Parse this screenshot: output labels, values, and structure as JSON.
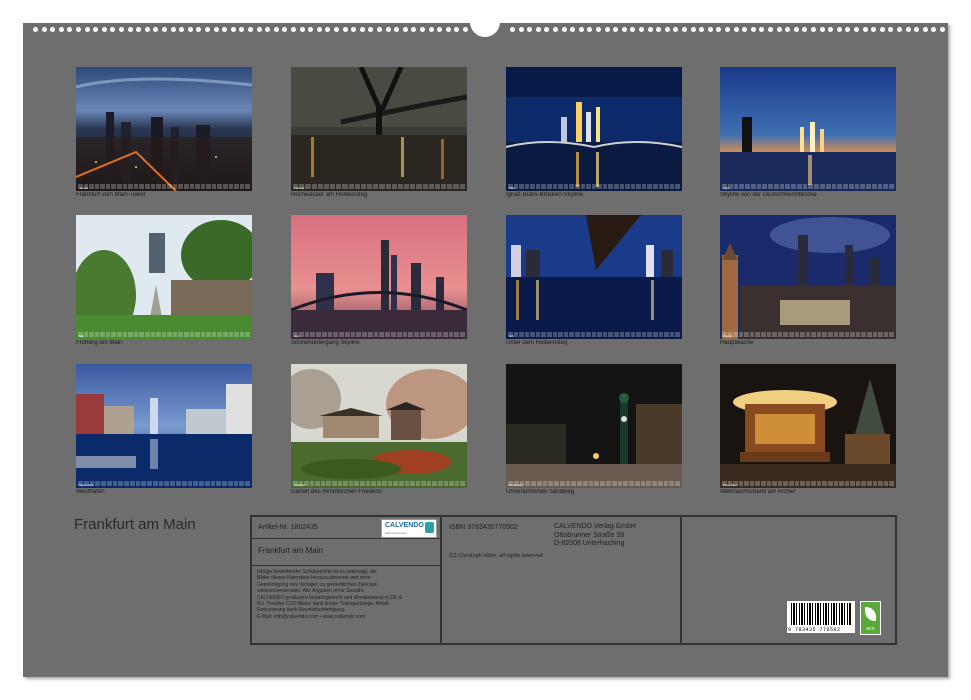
{
  "calendar_title": "Frankfurt am Main",
  "photos": [
    {
      "caption": "Frankfurt vom Main-Tower",
      "month": "Januar"
    },
    {
      "caption": "Hochwasser am Holbeinsteg",
      "month": "Februar"
    },
    {
      "caption": "Ignaz-Bubis-Brücken-Skyline",
      "month": "März"
    },
    {
      "caption": "Skyline von der Deutschherrnbrücke",
      "month": "April"
    },
    {
      "caption": "Frühling am Main",
      "month": "Mai"
    },
    {
      "caption": "Sonnenuntergang Skyline",
      "month": "Juni"
    },
    {
      "caption": "Unter dem Holbeinsteg",
      "month": "Juli"
    },
    {
      "caption": "Hauptwache",
      "month": "August"
    },
    {
      "caption": "Westhafen",
      "month": "September"
    },
    {
      "caption": "Garten des Himmlischen Friedens",
      "month": "Oktober"
    },
    {
      "caption": "Uhrentürmchen Sandweg",
      "month": "November"
    },
    {
      "caption": "Weihnachtsmarkt am Römer",
      "month": "Dezember"
    }
  ],
  "info": {
    "article_no": "Artikel-Nr. 1802435",
    "product_title": "Frankfurt am Main",
    "isbn": "ISBN 9783435770502",
    "publisher_line1": "CALVENDO Verlag GmbH",
    "publisher_line2": "Ottobrunner Straße 39",
    "publisher_line3": "D-82008 Unterhaching",
    "copyright": "(C) Christoph Höfer, all rights reserved",
    "legal_lines": [
      "Infolge bestehender Schutzrechte ist es untersagt, die",
      "Bilder dieses Kalenders herauszutrennen und ohne",
      "Genehmigung des Verlages zu gewerblichen Zwecken",
      "weiterzuverwenden. Alle Angaben ohne Gewähr.",
      "CALVENDO produziert bedarfsgerecht und klimabewusst in DE &",
      "EU. Positive CO2-Bilanz dank kurzer Transportwege. Abfall-",
      "Reduzierung dank Einzelstückfertigung.",
      "E-Mail: info@calvendo.com • www.calvendo.com"
    ],
    "logo_text": "CALVENDO",
    "logo_subtext": "kalender-photos",
    "barcode_number": "9 783435 770502",
    "eco_label": "eco"
  },
  "colors": {
    "page_background": "#6e6e6e",
    "calendar_sheet": "#6e6e6e",
    "text_dark": "#1a1a1a"
  }
}
